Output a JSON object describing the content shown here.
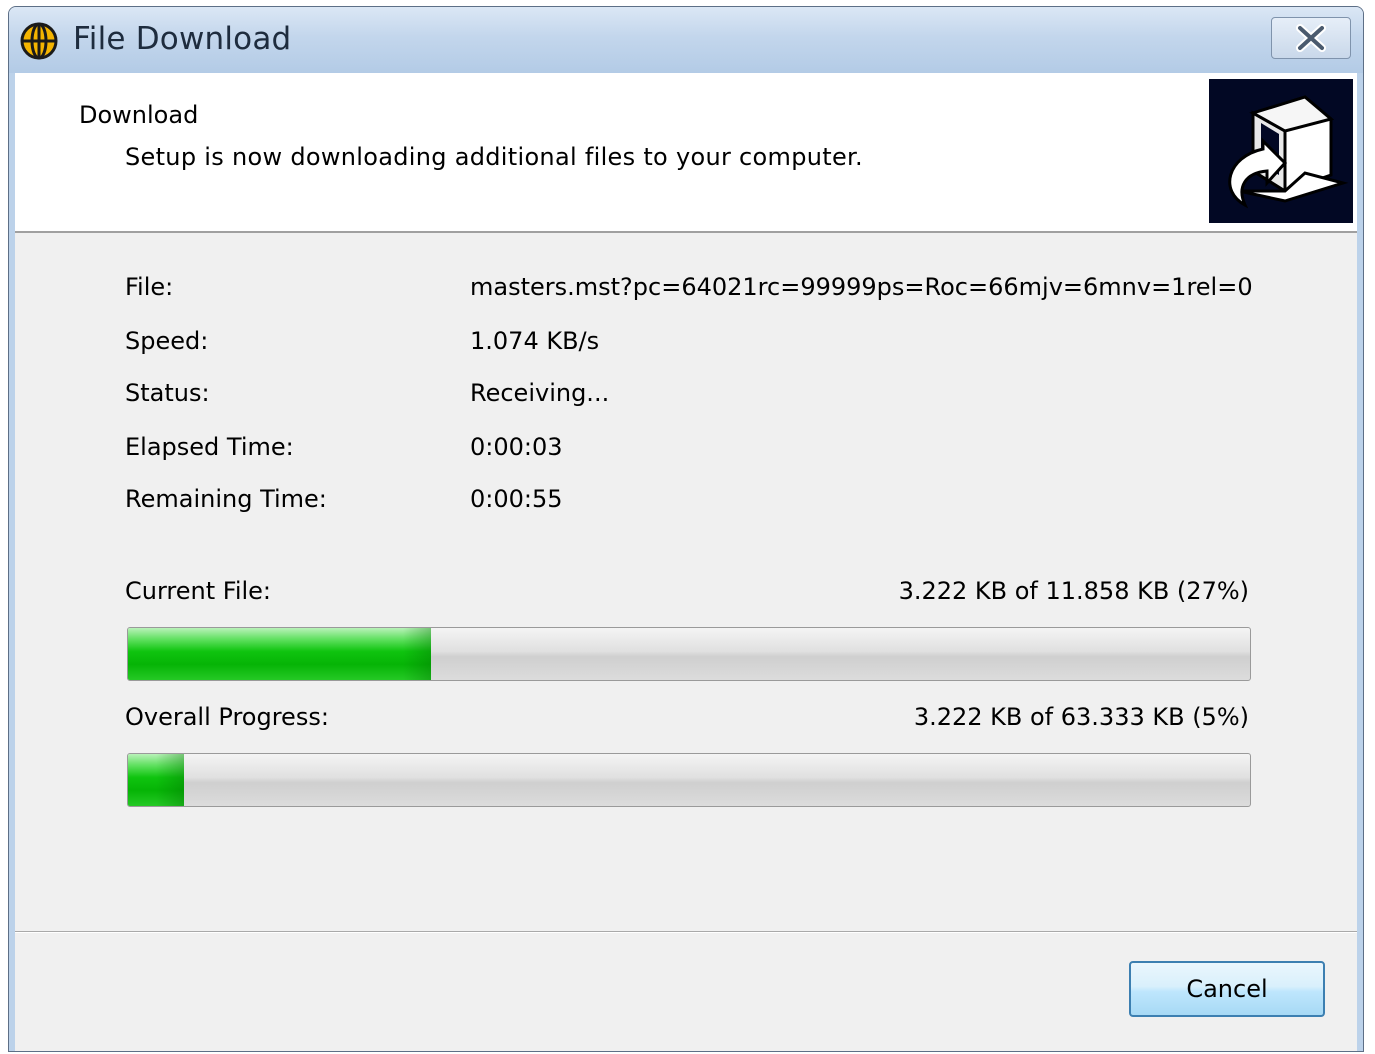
{
  "window": {
    "title": "File Download",
    "icon": "globe-icon",
    "close_icon": "close-icon"
  },
  "header": {
    "title": "Download",
    "subtitle": "Setup is now downloading additional files to your computer.",
    "image": "computer-download-icon"
  },
  "details": [
    {
      "label": "File:",
      "value": "masters.mst?pc=64021rc=99999ps=Roc=66mjv=6mnv=1rel=0"
    },
    {
      "label": "Speed:",
      "value": "1.074 KB/s"
    },
    {
      "label": "Status:",
      "value": "Receiving..."
    },
    {
      "label": "Elapsed Time:",
      "value": "0:00:03"
    },
    {
      "label": "Remaining Time:",
      "value": "0:00:55"
    }
  ],
  "current_file": {
    "label": "Current File:",
    "amount": "3.222 KB of 11.858 KB (27%)",
    "percent": 27
  },
  "overall": {
    "label": "Overall Progress:",
    "amount": "3.222 KB of 63.333 KB (5%)",
    "percent": 5
  },
  "buttons": {
    "cancel": "Cancel"
  },
  "colors": {
    "progress_green": "#06b406",
    "titlebar": "#c3d6ec",
    "button_border": "#3c7fb1"
  }
}
